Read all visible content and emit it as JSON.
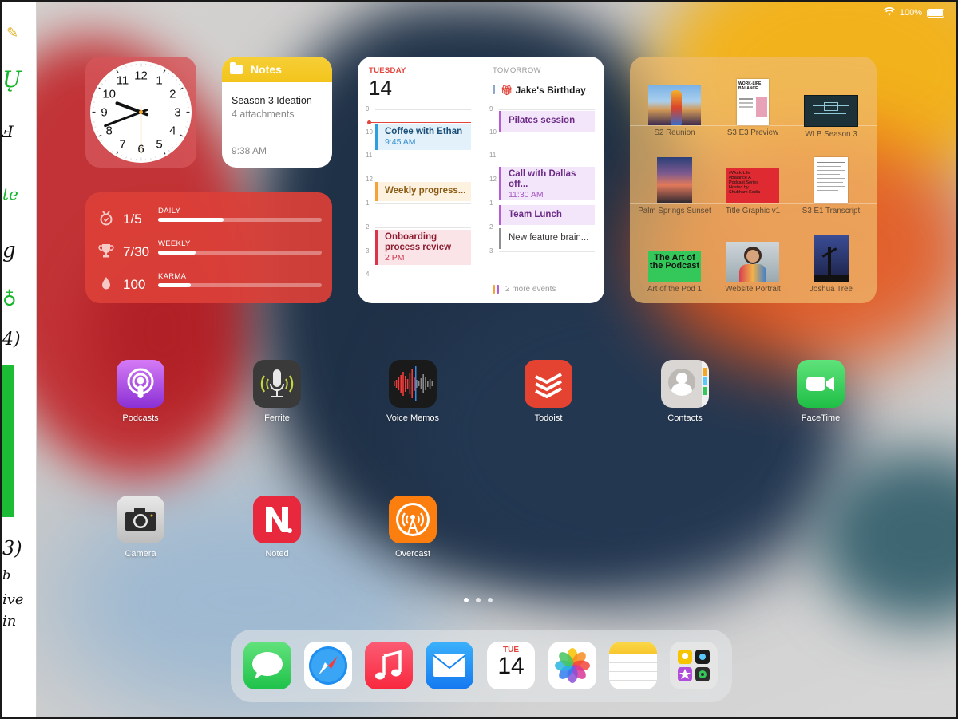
{
  "status_bar": {
    "battery": "100%"
  },
  "notes_widget": {
    "title": "Notes",
    "note_title": "Season 3 Ideation",
    "note_subtitle": "4 attachments",
    "time": "9:38 AM"
  },
  "clock_widget": {
    "numbers": [
      "12",
      "1",
      "2",
      "3",
      "4",
      "5",
      "6",
      "7",
      "8",
      "9",
      "10",
      "11"
    ],
    "time_hour": 9,
    "time_minute": 41,
    "time_second": 30
  },
  "streak_widget": {
    "rows": [
      {
        "icon": "medal-icon",
        "value": "1/5",
        "label": "DAILY",
        "progress": 0.4
      },
      {
        "icon": "trophy-icon",
        "value": "7/30",
        "label": "WEEKLY",
        "progress": 0.23
      },
      {
        "icon": "karma-drop-icon",
        "value": "100",
        "label": "KARMA",
        "progress": 0.2
      }
    ]
  },
  "calendar_widget": {
    "today": {
      "day": "TUESDAY",
      "date": "14",
      "hours": [
        "9",
        "10",
        "11",
        "12",
        "1",
        "2",
        "3",
        "4"
      ],
      "events": [
        {
          "title": "Coffee with Ethan",
          "time": "9:45 AM",
          "color": "#2f9ee0"
        },
        {
          "title": "Weekly progress...",
          "time": "",
          "color": "#f3a33a"
        },
        {
          "title": "Onboarding process review",
          "time": "2 PM",
          "color": "#d8344a"
        }
      ]
    },
    "tomorrow": {
      "day": "TOMORROW",
      "birthday": "Jake's Birthday",
      "hours": [
        "9",
        "10",
        "11",
        "12",
        "1",
        "2",
        "3"
      ],
      "events": [
        {
          "title": "Pilates session",
          "time": "",
          "color": "#b65bd6"
        },
        {
          "title": "Call with Dallas off...",
          "time": "11:30 AM",
          "color": "#b65bd6"
        },
        {
          "title": "Team Lunch",
          "time": "",
          "color": "#b65bd6"
        },
        {
          "title": "New feature brain...",
          "time": "",
          "color": "#8e8e93"
        }
      ],
      "more": "2 more events"
    }
  },
  "photos_widget": {
    "items": [
      {
        "label": "S2 Reunion"
      },
      {
        "label": "S3 E3 Preview",
        "thumb_text": "WORK-LIFE BALANCE"
      },
      {
        "label": "WLB Season 3"
      },
      {
        "label": "Palm Springs Sunset"
      },
      {
        "label": "Title Graphic v1",
        "thumb_text": "#Work-Life #Balance A Podcast Series Hosted by Shubham Kedia"
      },
      {
        "label": "S3 E1 Transcript"
      },
      {
        "label": "Art of the Pod 1",
        "thumb_text": "The Art of the Podcast"
      },
      {
        "label": "Website Portrait"
      },
      {
        "label": "Joshua Tree"
      }
    ]
  },
  "apps": [
    {
      "label": "Podcasts",
      "icon": "podcasts-icon"
    },
    {
      "label": "Ferrite",
      "icon": "ferrite-icon"
    },
    {
      "label": "Voice Memos",
      "icon": "voice-memos-icon"
    },
    {
      "label": "Todoist",
      "icon": "todoist-icon"
    },
    {
      "label": "Contacts",
      "icon": "contacts-icon"
    },
    {
      "label": "FaceTime",
      "icon": "facetime-icon"
    },
    {
      "label": "Camera",
      "icon": "camera-icon"
    },
    {
      "label": "Noted",
      "icon": "noted-icon"
    },
    {
      "label": "Overcast",
      "icon": "overcast-icon"
    }
  ],
  "dock": {
    "calendar_day": "TUE",
    "calendar_date": "14",
    "items": [
      "messages-icon",
      "safari-icon",
      "music-icon",
      "mail-icon",
      "calendar-icon",
      "photos-icon",
      "notes-icon",
      "app-folder-icon"
    ]
  },
  "page_dots": {
    "count": 3,
    "active": 0
  }
}
